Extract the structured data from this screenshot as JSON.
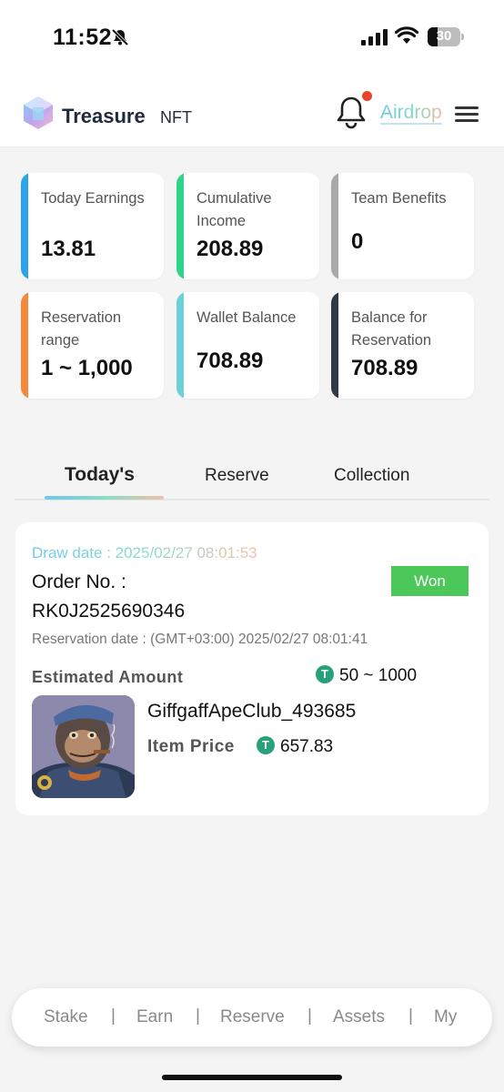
{
  "status_bar": {
    "time": "11:52",
    "battery": "30",
    "icons": [
      "bell-slash-icon",
      "signal-icon",
      "wifi-icon",
      "battery-icon"
    ]
  },
  "header": {
    "logo_text": "Treasure",
    "logo_sub": "NFT",
    "airdrop_label": "Airdrop",
    "icons": [
      "treasure-logo-icon",
      "bell-icon",
      "menu-icon"
    ],
    "notification_dot_color": "#e8452c"
  },
  "stats": [
    {
      "label": "Today Earnings",
      "value": "13.81",
      "color": "#2ba3ef"
    },
    {
      "label": "Cumulative Income",
      "value": "208.89",
      "color": "#2fd38a"
    },
    {
      "label": "Team Benefits",
      "value": "0",
      "color": "#a9a9a9"
    },
    {
      "label": "Reservation range",
      "value": "1 ~ 1,000",
      "color": "#f5893a"
    },
    {
      "label": "Wallet Balance",
      "value": "708.89",
      "color": "#6dcfd8"
    },
    {
      "label": "Balance for Reservation",
      "value": "708.89",
      "color": "#2f3a46"
    }
  ],
  "tabs": [
    {
      "label": "Today's",
      "active": true
    },
    {
      "label": "Reserve",
      "active": false
    },
    {
      "label": "Collection",
      "active": false
    }
  ],
  "order": {
    "draw_date": "Draw date : 2025/02/27 08:01:53",
    "order_no_label": "Order No. :",
    "order_no": "RK0J2525690346",
    "status": "Won",
    "reservation_date": "Reservation date : (GMT+03:00) 2025/02/27 08:01:41",
    "estimated_label": "Estimated Amount",
    "estimated_value": "50 ~ 1000",
    "item_name": "GiffgaffApeClub_493685",
    "price_label": "Item Price",
    "price_value": "657.83",
    "currency_icon": "tether-icon",
    "tether_glyph": "T"
  },
  "bottom_nav": {
    "items": [
      "Stake",
      "Earn",
      "Reserve",
      "Assets",
      "My"
    ],
    "separator": "|"
  }
}
